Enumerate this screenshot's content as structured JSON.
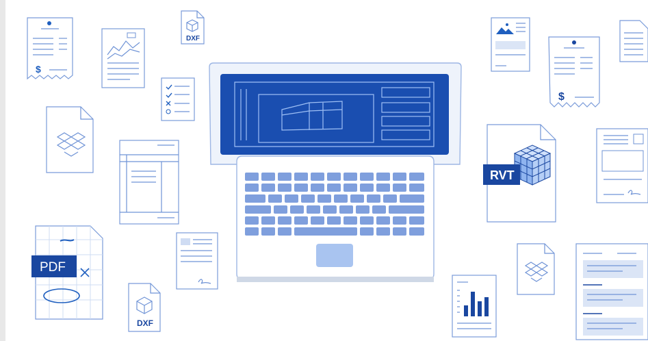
{
  "labels": {
    "dxf_top": "DXF",
    "dxf_bottom": "DXF",
    "pdf": "PDF",
    "rvt": "RVT",
    "dollar_left": "$",
    "dollar_right": "$"
  },
  "colors": {
    "accent": "#1f5fbf",
    "navy": "#1a47a0",
    "line": "#6f93d6",
    "light": "#cfdcf3",
    "paper": "#ffffff",
    "key": "#7f9fdd",
    "touchpad": "#a9c4f0",
    "screen": "#1a4eb0"
  }
}
